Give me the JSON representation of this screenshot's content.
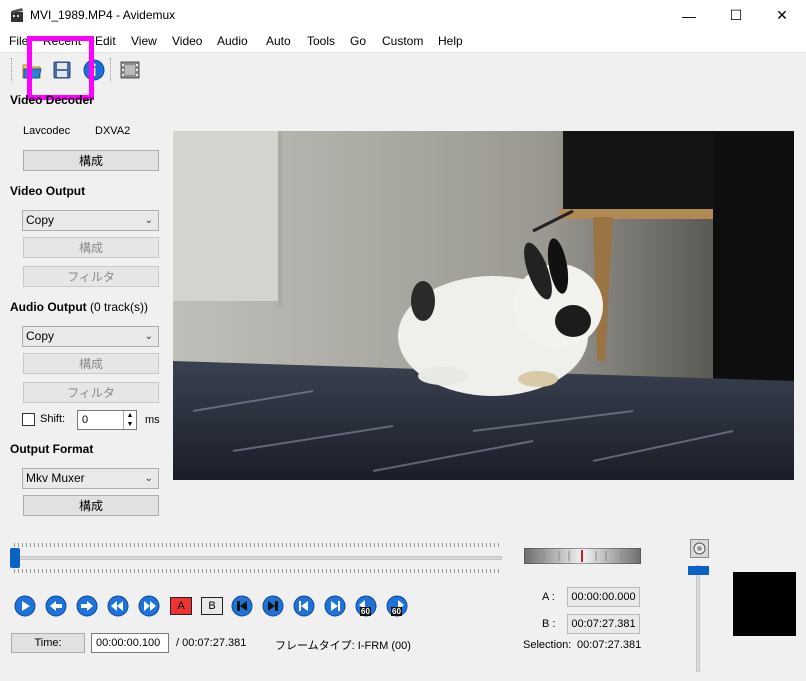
{
  "window": {
    "title": "MVI_1989.MP4 - Avidemux",
    "minimize": "—",
    "maximize": "☐",
    "close": "✕"
  },
  "menu": {
    "file": "File",
    "recent": "Recent",
    "edit": "Edit",
    "view": "View",
    "video": "Video",
    "audio": "Audio",
    "auto": "Auto",
    "tools": "Tools",
    "go": "Go",
    "custom": "Custom",
    "help": "Help"
  },
  "toolbar": {
    "icons": [
      "open-folder-icon",
      "save-floppy-icon",
      "info-icon",
      "film-strip-icon"
    ]
  },
  "video_decoder": {
    "title": "Video Decoder",
    "codec": "Lavcodec",
    "hw": "DXVA2",
    "configure": "構成"
  },
  "video_output": {
    "title": "Video Output",
    "codec": "Copy",
    "configure": "構成",
    "filters": "フィルタ"
  },
  "audio_output": {
    "title": "Audio Output",
    "tracks": "(0 track(s))",
    "codec": "Copy",
    "configure": "構成",
    "filters": "フィルタ",
    "shift_label": "Shift:",
    "shift_value": "0",
    "shift_unit": "ms"
  },
  "output_format": {
    "title": "Output Format",
    "muxer": "Mkv Muxer",
    "configure": "構成"
  },
  "status": {
    "time_button": "Time:",
    "current_time": "00:00:00.100",
    "total_time": "/ 00:07:27.381",
    "frame_type": "フレームタイプ: I-FRM (00)"
  },
  "selection": {
    "a_label": "A :",
    "a_value": "00:00:00.000",
    "b_label": "B :",
    "b_value": "00:07:27.381",
    "selection_label": "Selection:",
    "selection_value": "00:07:27.381"
  },
  "transport": {
    "marker_a": "A",
    "marker_b": "B",
    "skip_label": "60"
  },
  "slider_position": 0.0,
  "colors": {
    "accent": "#0a62c6",
    "highlight": "#ff00ff"
  }
}
